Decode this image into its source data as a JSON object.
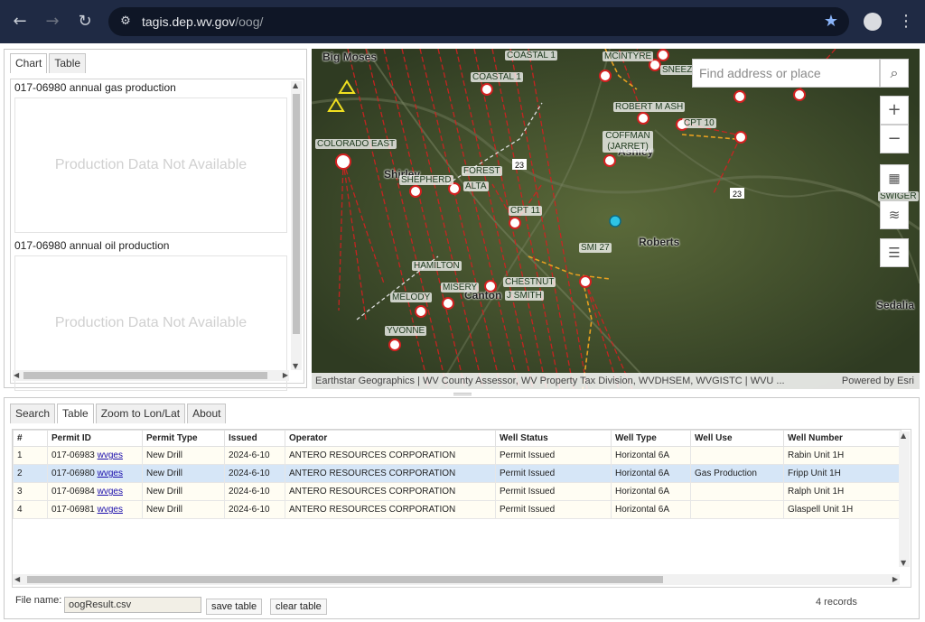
{
  "browser": {
    "url_domain": "tagis.dep.wv.gov",
    "url_path": "/oog/",
    "back_icon": "arrow-left",
    "forward_icon": "arrow-right",
    "reload_icon": "reload",
    "bookmark_icon": "star"
  },
  "left_panel": {
    "tabs": [
      "Chart",
      "Table"
    ],
    "active_tab": "Chart",
    "gas_title": "017-06980 annual gas production",
    "oil_title": "017-06980 annual oil production",
    "no_data": "Production Data Not Available"
  },
  "map": {
    "search_placeholder": "Find address or place",
    "attribution": "Earthstar Geographics | WV County Assessor, WV Property Tax Division, WVDHSEM, WVGISTC | WVU ...",
    "powered_by": "Powered by Esri",
    "well_labels": [
      "COASTAL 1",
      "COASTAL 1",
      "MCINTYRE",
      "SNEEZ",
      "ROBERT M ASH",
      "CPT 10",
      "COFFMAN (JARRET)",
      "COLORADO EAST",
      "FOREST",
      "SHEPHERD",
      "ALTA",
      "CPT 11",
      "SWIGER",
      "SMI 27",
      "HAMILTON",
      "CHESTNUT",
      "MISERY",
      "J SMITH",
      "MELODY",
      "YVONNE"
    ],
    "place_labels": [
      "Big Moses",
      "Shirley",
      "Ashley",
      "Roberts",
      "Canton",
      "Sedalia"
    ],
    "route_labels": [
      "23",
      "23"
    ],
    "colors": {
      "well_lines": "#d42020",
      "pipelines": "#e8a020",
      "selected_well": "#2ec4e6"
    }
  },
  "bottom_panel": {
    "tabs": [
      "Search",
      "Table",
      "Zoom to Lon/Lat",
      "About"
    ],
    "active_tab": "Table",
    "columns": [
      "#",
      "Permit ID",
      "Permit Type",
      "Issued",
      "Operator",
      "Well Status",
      "Well Type",
      "Well Use",
      "Well Number"
    ],
    "link_text": "wvges",
    "rows": [
      {
        "n": "1",
        "permit_id": "017-06983",
        "permit_type": "New Drill",
        "issued": "2024-6-10",
        "operator": "ANTERO RESOURCES CORPORATION",
        "status": "Permit Issued",
        "type": "Horizontal 6A",
        "use": "",
        "number": "Rabin Unit 1H"
      },
      {
        "n": "2",
        "permit_id": "017-06980",
        "permit_type": "New Drill",
        "issued": "2024-6-10",
        "operator": "ANTERO RESOURCES CORPORATION",
        "status": "Permit Issued",
        "type": "Horizontal 6A",
        "use": "Gas Production",
        "number": "Fripp Unit 1H"
      },
      {
        "n": "3",
        "permit_id": "017-06984",
        "permit_type": "New Drill",
        "issued": "2024-6-10",
        "operator": "ANTERO RESOURCES CORPORATION",
        "status": "Permit Issued",
        "type": "Horizontal 6A",
        "use": "",
        "number": "Ralph Unit 1H"
      },
      {
        "n": "4",
        "permit_id": "017-06981",
        "permit_type": "New Drill",
        "issued": "2024-6-10",
        "operator": "ANTERO RESOURCES CORPORATION",
        "status": "Permit Issued",
        "type": "Horizontal 6A",
        "use": "",
        "number": "Glaspell Unit 1H"
      }
    ],
    "file_label": "File name:",
    "file_value": "oogResult.csv",
    "save_label": "save table",
    "clear_label": "clear table",
    "records": "4 records"
  }
}
